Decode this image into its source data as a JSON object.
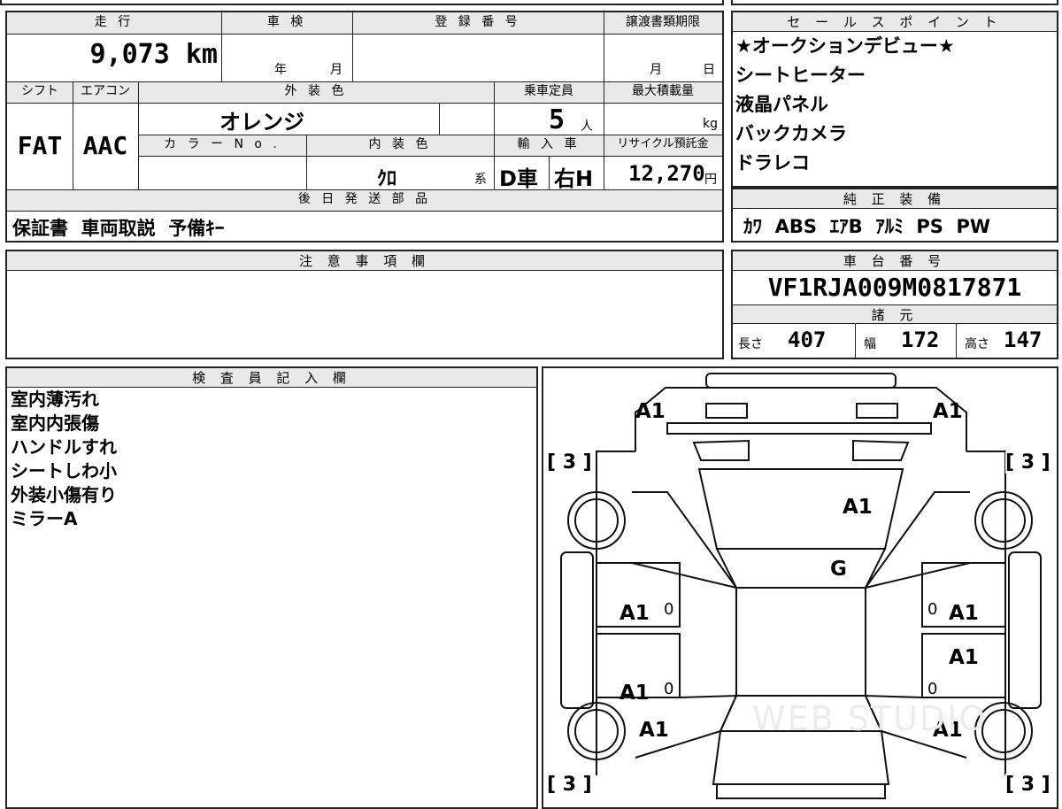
{
  "top": {
    "h_mileage": "走 行",
    "h_inspection": "車 検",
    "h_reg": "登 録 番 号",
    "h_transfer": "譲渡書類期限",
    "mileage": "9,073 km",
    "inspection_year": "年",
    "inspection_month": "月",
    "transfer_month": "月",
    "transfer_day": "日",
    "h_shift": "シフト",
    "h_ac": "エアコン",
    "h_color": "外 装 色",
    "h_capacity": "乗車定員",
    "h_maxload": "最大積載量",
    "color": "オレンジ",
    "capacity": "5",
    "capacity_unit": "人",
    "load_unit": "kg",
    "shift": "FAT",
    "ac": "AAC",
    "h_color_no": "カ ラ ー N o .",
    "h_interior": "内 装 色",
    "h_import": "輸 入 車",
    "h_recycle": "リサイクル預託金",
    "interior": "ｸﾛ",
    "interior_unit": "系",
    "import_type": "D車",
    "handle": "右H",
    "recycle": "12,270",
    "recycle_unit": "円",
    "h_later": "後 日 発 送 部 品",
    "later": "保証書  車両取説  予備ｷｰ"
  },
  "sales": {
    "header": "セ ー ル ス ポ イ ン ト",
    "items": [
      "★オークションデビュー★",
      "シートヒーター",
      "液晶パネル",
      "バックカメラ",
      "ドラレコ"
    ]
  },
  "equipment": {
    "header": "純 正 装 備",
    "value": "ｶﾜ  ABS  ｴｱB  ｱﾙﾐ  PS  PW"
  },
  "notes": {
    "header": "注 意 事 項 欄",
    "body": ""
  },
  "chassis": {
    "header": "車 台 番 号",
    "number": "VF1RJA009M0817871",
    "spec_header": "諸 元",
    "length_label": "長さ",
    "length": "407",
    "width_label": "幅",
    "width": "172",
    "height_label": "高さ",
    "height": "147"
  },
  "inspector": {
    "header": "検 査 員 記 入 欄",
    "lines": [
      "室内薄汚れ",
      "室内内張傷",
      "ハンドルすれ",
      "シートしわ小",
      "外装小傷有り",
      "ミラーA"
    ]
  },
  "diagram": {
    "marks": {
      "front_left": "A1",
      "front_right": "A1",
      "bonnet": "A1",
      "windshield": "G",
      "left_front_door": "A1",
      "right_front_door": "A1",
      "right_rear_door": "A1",
      "left_rear_door": "A1",
      "left_rear_fender": "A1",
      "right_rear_fender": "A1",
      "zero_1": "0",
      "zero_2": "0",
      "zero_3": "0",
      "zero_4": "0",
      "tire_fl": "[ 3 ]",
      "tire_fr": "[ 3 ]",
      "tire_rl": "[ 3 ]",
      "tire_rr": "[ 3 ]"
    },
    "watermark": "WEB STUDIO"
  }
}
